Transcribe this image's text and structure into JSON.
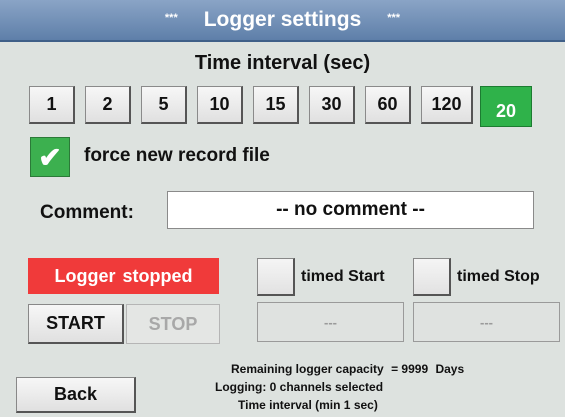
{
  "header": {
    "title": "Logger settings",
    "stars_left": "***",
    "stars_right": "***"
  },
  "interval": {
    "heading": "Time interval (sec)",
    "options": [
      "1",
      "2",
      "5",
      "10",
      "15",
      "30",
      "60",
      "120"
    ],
    "current_value": "20"
  },
  "record": {
    "checkbox_mark": "✔",
    "label": "force new record file",
    "checked": true
  },
  "comment": {
    "label": "Comment:",
    "value": "-- no comment --"
  },
  "status": {
    "word1": "Logger",
    "word2": "stopped",
    "color": "#f03a3a"
  },
  "controls": {
    "start_label": "START",
    "stop_label": "STOP"
  },
  "timed": {
    "start_label": "timed Start",
    "stop_label": "timed Stop",
    "start_value": "---",
    "stop_value": "---"
  },
  "info": {
    "capacity_label": "Remaining logger capacity",
    "capacity_eq": "=",
    "capacity_value": "9999",
    "capacity_unit": "Days",
    "channels": "Logging: 0 channels selected",
    "interval_note": "Time interval (min 1 sec)"
  },
  "footer": {
    "back_label": "Back"
  },
  "colors": {
    "accent_green": "#2fb24a",
    "title_blue": "#6f8fb8"
  }
}
